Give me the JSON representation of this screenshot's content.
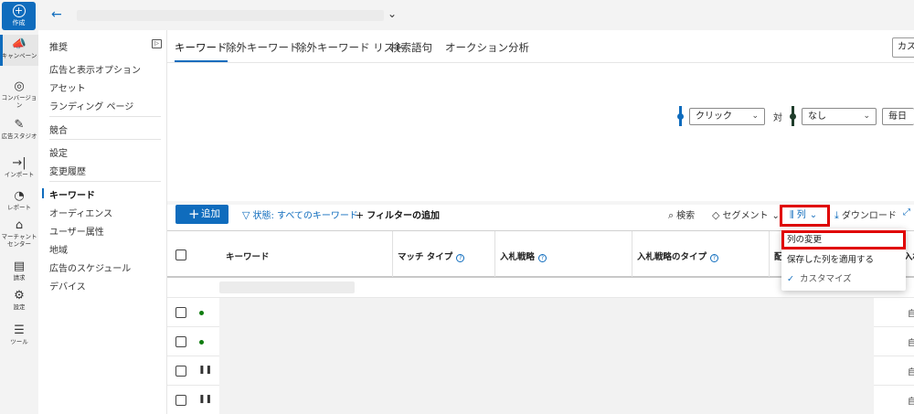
{
  "rail": {
    "create_label": "作成",
    "items": [
      {
        "label": "キャンペーン",
        "icon": "megaphone-icon",
        "glyph": "📣",
        "active": true
      },
      {
        "label": "コンバージョン",
        "icon": "target-icon",
        "glyph": "◎",
        "active": false
      },
      {
        "label": "広告スタジオ",
        "icon": "studio-icon",
        "glyph": "✎",
        "active": false
      },
      {
        "label": "インポート",
        "icon": "import-icon",
        "glyph": "→|",
        "active": false
      },
      {
        "label": "レポート",
        "icon": "report-icon",
        "glyph": "◔",
        "active": false
      },
      {
        "label": "マーチャント センター",
        "icon": "merchant-icon",
        "glyph": "⌂",
        "active": false
      },
      {
        "label": "請求",
        "icon": "billing-icon",
        "glyph": "▤",
        "active": false
      },
      {
        "label": "設定",
        "icon": "gear-icon",
        "glyph": "⚙",
        "active": false
      },
      {
        "label": "ツール",
        "icon": "tools-icon",
        "glyph": "☰",
        "active": false
      }
    ]
  },
  "subnav": {
    "recommend": "推奨",
    "ads_options": "広告と表示オプション",
    "assets": "アセット",
    "landing": "ランディング ページ",
    "competition": "競合",
    "settings": "設定",
    "history": "変更履歴",
    "keywords": "キーワード",
    "audience": "オーディエンス",
    "user_attr": "ユーザー属性",
    "region": "地域",
    "schedule": "広告のスケジュール",
    "devices": "デバイス"
  },
  "tabs": {
    "keywords": "キーワード",
    "negative": "除外キーワード",
    "negative_list": "除外キーワード リスト",
    "search_terms": "検索語句",
    "auction": "オークション分析",
    "custom": "カスタム"
  },
  "chart_controls": {
    "metric1": "クリック",
    "vs": "対",
    "metric2": "なし",
    "period": "毎日",
    "metric1_color": "#0f6cbd",
    "metric2_color": "#1f3d2b"
  },
  "toolbar": {
    "add_label": "追加",
    "filter_status": "状態: すべてのキーワード",
    "add_filter": "フィルターの追加",
    "search": "検索",
    "segment": "セグメント",
    "columns": "列",
    "download": "ダウンロード"
  },
  "table": {
    "col_keyword": "キーワード",
    "col_match": "マッチ タイプ",
    "col_bid_strategy": "入札戦略",
    "col_bid_strategy_type": "入札戦略のタイプ",
    "col_partial_left": "配",
    "col_partial_right": "入札",
    "rows": [
      {
        "status": "active",
        "auto": "自"
      },
      {
        "status": "active",
        "auto": "自"
      },
      {
        "status": "paused",
        "auto": "自"
      },
      {
        "status": "paused",
        "auto": "自"
      }
    ]
  },
  "dropdown": {
    "change_columns": "列の変更",
    "apply_saved": "保存した列を適用する",
    "customize": "カスタマイズ"
  }
}
